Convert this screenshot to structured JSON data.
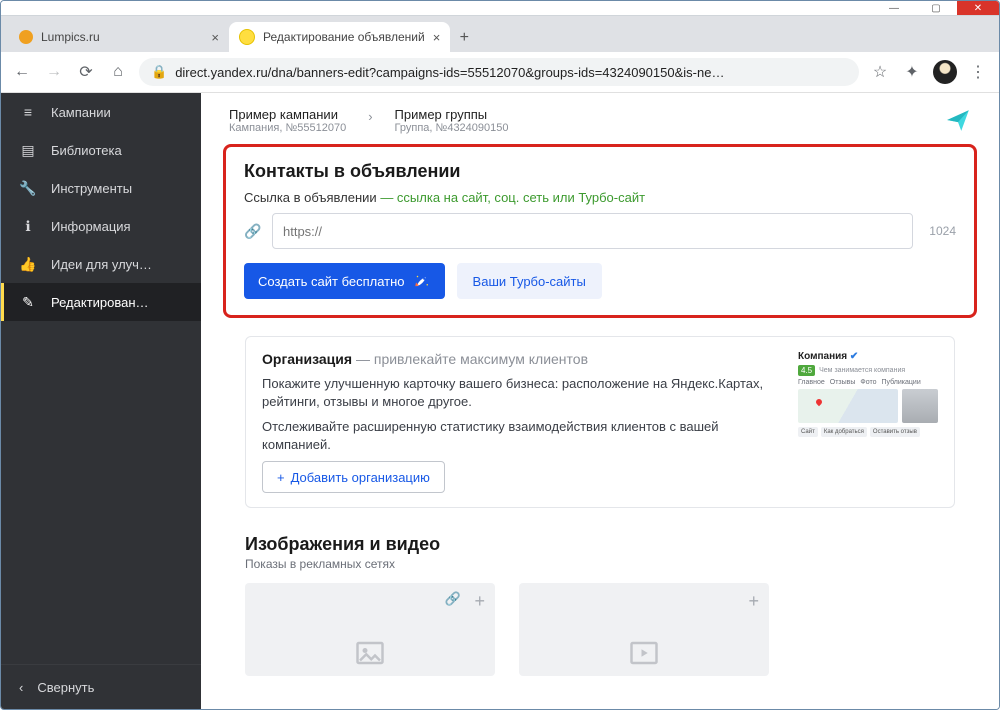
{
  "window": {
    "min": "—",
    "max": "▢",
    "close": "✕"
  },
  "tabs": [
    {
      "label": "Lumpics.ru",
      "favcolor": "#f0a020"
    },
    {
      "label": "Редактирование объявлений",
      "favcolor": "#ffde40"
    }
  ],
  "addr": {
    "url": "direct.yandex.ru/dna/banners-edit?campaigns-ids=55512070&groups-ids=4324090150&is-ne…"
  },
  "sidebar": {
    "items": [
      {
        "icon": "≡",
        "label": "Кампании"
      },
      {
        "icon": "▤",
        "label": "Библиотека"
      },
      {
        "icon": "🔧",
        "label": "Инструменты"
      },
      {
        "icon": "ℹ",
        "label": "Информация"
      },
      {
        "icon": "👍",
        "label": "Идеи для улуч…"
      },
      {
        "icon": "✎",
        "label": "Редактирован…"
      }
    ],
    "collapse": "Свернуть"
  },
  "crumbs": {
    "campaign_title": "Пример кампании",
    "campaign_sub": "Кампания, №55512070",
    "group_title": "Пример группы",
    "group_sub": "Группа, №4324090150"
  },
  "contacts": {
    "heading": "Контакты в объявлении",
    "label": "Ссылка в объявлении",
    "hint": "— ссылка на сайт, соц. сеть или Турбо-сайт",
    "placeholder": "https://",
    "counter": "1024",
    "btn_create": "Создать сайт бесплатно",
    "btn_turbo": "Ваши Турбо-сайты"
  },
  "org": {
    "title": "Организация",
    "dash": "— привлекайте максимум клиентов",
    "p1": "Покажите улучшенную карточку вашего бизнеса: расположение на Яндекс.Картах, рейтинги, отзывы и многое другое.",
    "p2": "Отслеживайте расширенную статистику взаимодействия клиентов с вашей компанией.",
    "btn": "Добавить организацию",
    "preview": {
      "title": "Компания",
      "rating": "4.5",
      "about": "Чем занимается компания",
      "tabs": [
        "Главное",
        "Отзывы",
        "Фото",
        "Публикации"
      ],
      "chips": [
        "Сайт",
        "Как добраться",
        "Оставить отзыв"
      ]
    }
  },
  "media": {
    "heading": "Изображения и видео",
    "sub": "Показы в рекламных сетях"
  }
}
